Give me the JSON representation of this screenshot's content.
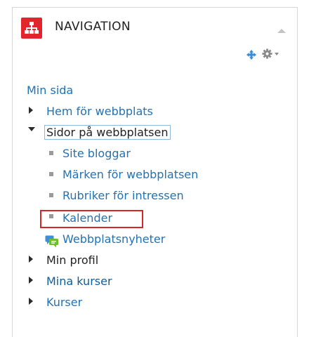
{
  "block": {
    "title": "NAVIGATION",
    "accent_color": "#e2242d",
    "icons": [
      "navigation-sitemap-icon",
      "collapse-icon",
      "move-icon",
      "gear-icon",
      "chevron-down-icon"
    ]
  },
  "tree": {
    "root": "Min sida",
    "items": [
      {
        "label": "Hem för webbplats",
        "state": "collapsed"
      },
      {
        "label": "Sidor på webbplatsen",
        "state": "expanded",
        "focused": true,
        "children": [
          {
            "label": "Site bloggar"
          },
          {
            "label": "Märken för webbplatsen"
          },
          {
            "label": "Rubriker för intressen"
          },
          {
            "label": "Kalender",
            "highlighted": true
          },
          {
            "label": "Webbplatsnyheter",
            "icon": "forum-icon"
          }
        ]
      },
      {
        "label": "Min profil",
        "state": "collapsed"
      },
      {
        "label": "Mina kurser",
        "state": "collapsed"
      },
      {
        "label": "Kurser",
        "state": "collapsed"
      }
    ]
  }
}
